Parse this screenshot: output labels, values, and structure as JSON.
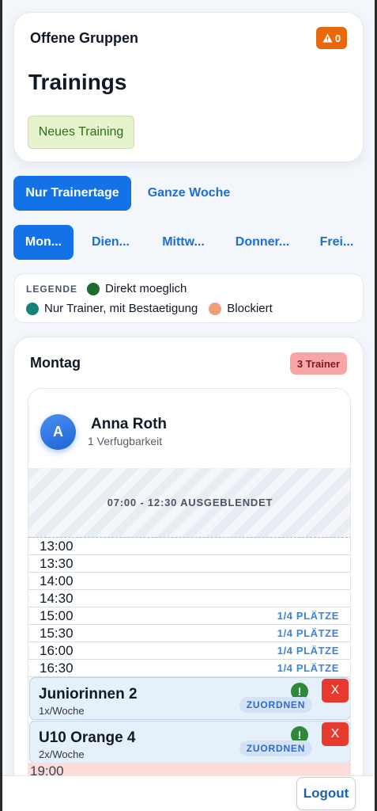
{
  "header": {
    "title": "Offene Gruppen",
    "warning_count": "0",
    "heading": "Trainings",
    "new_button": "Neues Training"
  },
  "view_toggle": {
    "active": "Nur Trainertage",
    "other": "Ganze Woche"
  },
  "day_tabs": [
    "Mon...",
    "Dien...",
    "Mittw...",
    "Donner...",
    "Frei..."
  ],
  "legend": {
    "title": "LEGENDE",
    "items": [
      {
        "label": "Direkt moeglich",
        "color": "#1e6b2e"
      },
      {
        "label": "Nur Trainer, mit Bestaetigung",
        "color": "#13847a"
      },
      {
        "label": "Blockiert",
        "color": "#ee9f7a"
      }
    ]
  },
  "day": {
    "title": "Montag",
    "trainer_badge": "3 Trainer",
    "trainer": {
      "initial": "A",
      "name": "Anna Roth",
      "availability": "1 Verfugbarkeit",
      "hidden_range": "07:00 - 12:30 AUSGEBLENDET",
      "slots": [
        {
          "time": "13:00",
          "capacity": ""
        },
        {
          "time": "13:30",
          "capacity": ""
        },
        {
          "time": "14:00",
          "capacity": ""
        },
        {
          "time": "14:30",
          "capacity": ""
        },
        {
          "time": "15:00",
          "capacity": "1/4 PLÄTZE"
        },
        {
          "time": "15:30",
          "capacity": "1/4 PLÄTZE"
        },
        {
          "time": "16:00",
          "capacity": "1/4 PLÄTZE"
        },
        {
          "time": "16:30",
          "capacity": "1/4 PLÄTZE"
        }
      ],
      "groups": [
        {
          "name": "Juniorinnen 2",
          "frequency": "1x/Woche",
          "assign": "ZUORDNEN",
          "remove": "X",
          "alert": "!"
        },
        {
          "name": "U10 Orange 4",
          "frequency": "2x/Woche",
          "assign": "ZUORDNEN",
          "remove": "X",
          "alert": "!"
        }
      ],
      "blocked_time": "19:00"
    }
  },
  "footer": {
    "logout": "Logout"
  },
  "colors": {
    "primary": "#1373e6",
    "warning": "#e8690c",
    "danger": "#e8392f"
  }
}
